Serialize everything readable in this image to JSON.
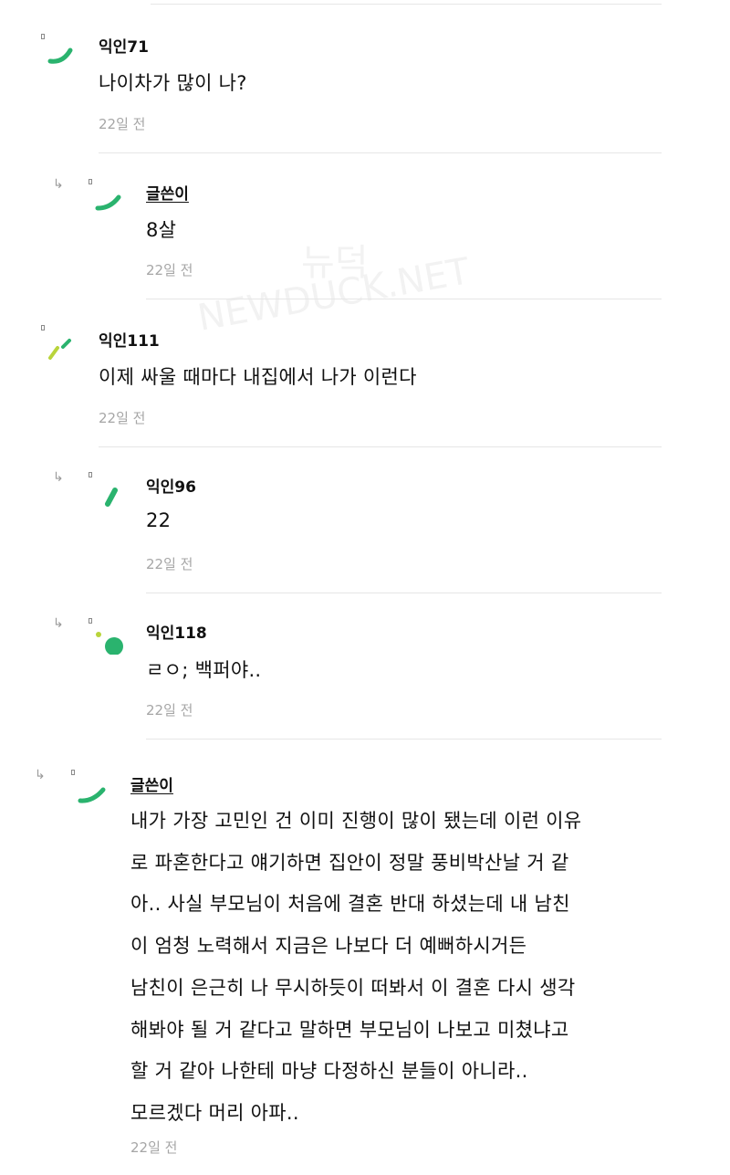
{
  "watermark": {
    "korean": "뉴덕",
    "latin": "NEWDUCK.NET"
  },
  "comments": [
    {
      "author": "익인71",
      "text": "나이차가 많이 나?",
      "time": "22일 전"
    },
    {
      "author": "글쓴이",
      "text": "8살",
      "time": "22일 전"
    },
    {
      "author": "익인111",
      "text": "이제 싸울 때마다 내집에서 나가 이런다",
      "time": "22일 전"
    },
    {
      "author": "익인96",
      "text": "22",
      "time": "22일 전"
    },
    {
      "author": "익인118",
      "text": "ㄹㅇ; 백퍼야..",
      "time": "22일 전"
    },
    {
      "author": "글쓴이",
      "lines": [
        "내가 가장 고민인 건 이미 진행이 많이 됐는데 이런 이유",
        "로 파혼한다고 얘기하면 집안이 정말 풍비박산날 거 같",
        "아.. 사실 부모님이 처음에 결혼 반대 하셨는데 내 남친",
        "이 엄청 노력해서 지금은 나보다 더 예뻐하시거든",
        "남친이 은근히 나 무시하듯이 떠봐서 이 결혼 다시 생각",
        "해봐야 될 거 같다고 말하면 부모님이 나보고 미쳤냐고",
        "할 거 같아 나한테 마냥 다정하신 분들이 아니라..",
        "모르겠다 머리 아파.."
      ],
      "time": "22일 전"
    }
  ]
}
